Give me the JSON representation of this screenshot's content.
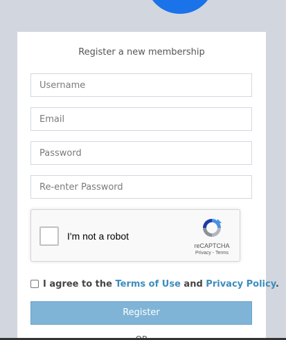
{
  "colors": {
    "page_bg": "#d2d6de",
    "logo_blue": "#1a73e8",
    "link": "#3c8dbc",
    "register_button": "#7fb4d6"
  },
  "box_message": "Register a new membership",
  "form": {
    "username_placeholder": "Username",
    "email_placeholder": "Email",
    "password_placeholder": "Password",
    "reenter_password_placeholder": "Re-enter Password"
  },
  "recaptcha": {
    "label": "I'm not a robot",
    "brand": "reCAPTCHA",
    "privacy": "Privacy",
    "separator": " - ",
    "terms": "Terms",
    "icon": "recaptcha-logo"
  },
  "agreement": {
    "prefix": "I agree to the ",
    "terms_link": "Terms of Use",
    "middle": " and ",
    "privacy_link": "Privacy Policy",
    "suffix": "."
  },
  "register_button": "Register",
  "divider_text": "OR"
}
